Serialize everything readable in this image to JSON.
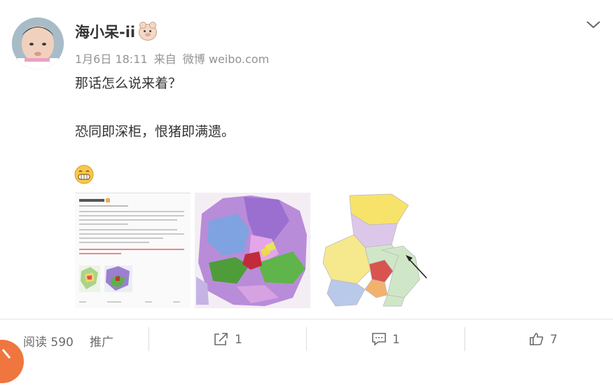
{
  "post": {
    "author": "海小呆-ii",
    "time": "1月6日 18:11",
    "source_prefix": "来自",
    "source": "微博 weibo.com",
    "line1": "那话怎么说来着？",
    "line2": "恐同即深柜，恨猪即满遗。"
  },
  "stats": {
    "read_label": "阅读",
    "read_count": "590",
    "promote_label": "推广",
    "repost_count": "1",
    "comment_count": "1",
    "like_count": "7"
  },
  "icons": {
    "menu": "chevron-down-icon",
    "badge": "pig-badge-icon",
    "emoji": "grin-emoji-icon",
    "repost": "repost-icon",
    "comment": "comment-icon",
    "like": "thumbs-up-icon"
  },
  "colors": {
    "text": "#333333",
    "meta": "#939393",
    "stat": "#6b6b6b",
    "accent_corner": "#f0763f"
  }
}
